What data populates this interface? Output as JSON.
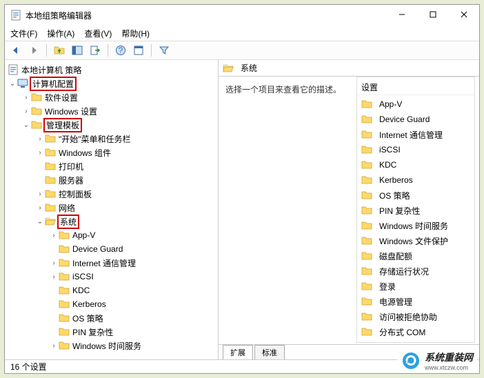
{
  "window": {
    "title": "本地组策略编辑器"
  },
  "menu": {
    "file": "文件(F)",
    "action": "操作(A)",
    "view": "查看(V)",
    "help": "帮助(H)"
  },
  "tree": {
    "root": "本地计算机 策略",
    "computer_config": "计算机配置",
    "software_settings": "软件设置",
    "windows_settings": "Windows 设置",
    "admin_templates": "管理模板",
    "start_taskbar": "\"开始\"菜单和任务栏",
    "windows_components": "Windows 组件",
    "printers": "打印机",
    "servers": "服务器",
    "control_panel": "控制面板",
    "network": "网络",
    "system": "系统",
    "appv": "App-V",
    "device_guard": "Device Guard",
    "internet_comm": "Internet 通信管理",
    "iscsi": "iSCSI",
    "kdc": "KDC",
    "kerberos": "Kerberos",
    "os_policy": "OS 策略",
    "pin_complexity": "PIN 复杂性",
    "windows_time": "Windows 时间服务"
  },
  "right": {
    "header": "系统",
    "description": "选择一个项目来查看它的描述。",
    "settings_label": "设置",
    "items": {
      "appv": "App-V",
      "device_guard": "Device Guard",
      "internet_comm": "Internet 通信管理",
      "iscsi": "iSCSI",
      "kdc": "KDC",
      "kerberos": "Kerberos",
      "os_policy": "OS 策略",
      "pin_complexity": "PIN 复杂性",
      "windows_time": "Windows 时间服务",
      "windows_fileprotect": "Windows 文件保护",
      "disk_quota": "磁盘配额",
      "storage_health": "存储运行状况",
      "logon": "登录",
      "power_management": "电源管理",
      "access_denied": "访问被拒绝协助",
      "distributed_com": "分布式 COM"
    }
  },
  "tabs": {
    "extended": "扩展",
    "standard": "标准"
  },
  "status": {
    "count": "16 个设置"
  },
  "watermark": {
    "text": "系统重装网",
    "url": "www.xtczw.com"
  }
}
